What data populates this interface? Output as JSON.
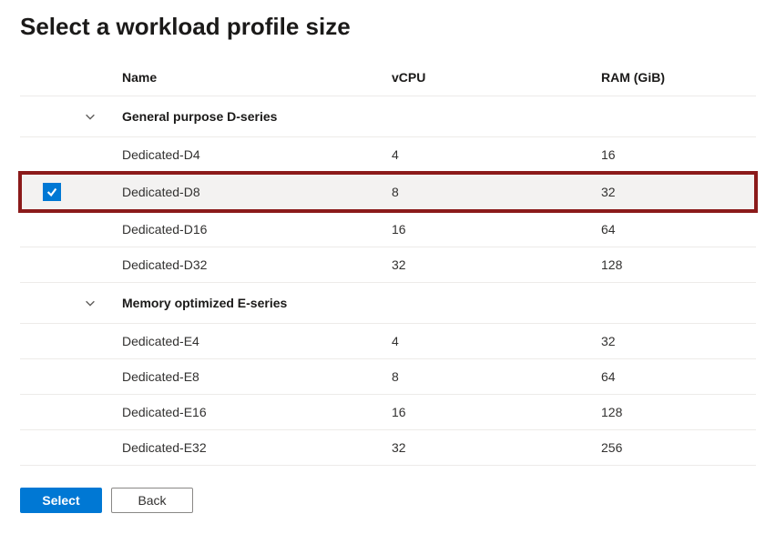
{
  "title": "Select a workload profile size",
  "columns": {
    "name": "Name",
    "vcpu": "vCPU",
    "ram": "RAM (GiB)"
  },
  "groups": [
    {
      "label": "General purpose D-series",
      "rows": [
        {
          "name": "Dedicated-D4",
          "vcpu": "4",
          "ram": "16",
          "selected": false
        },
        {
          "name": "Dedicated-D8",
          "vcpu": "8",
          "ram": "32",
          "selected": true
        },
        {
          "name": "Dedicated-D16",
          "vcpu": "16",
          "ram": "64",
          "selected": false
        },
        {
          "name": "Dedicated-D32",
          "vcpu": "32",
          "ram": "128",
          "selected": false
        }
      ]
    },
    {
      "label": "Memory optimized E-series",
      "rows": [
        {
          "name": "Dedicated-E4",
          "vcpu": "4",
          "ram": "32",
          "selected": false
        },
        {
          "name": "Dedicated-E8",
          "vcpu": "8",
          "ram": "64",
          "selected": false
        },
        {
          "name": "Dedicated-E16",
          "vcpu": "16",
          "ram": "128",
          "selected": false
        },
        {
          "name": "Dedicated-E32",
          "vcpu": "32",
          "ram": "256",
          "selected": false
        }
      ]
    }
  ],
  "buttons": {
    "select": "Select",
    "back": "Back"
  },
  "highlight_color": "#8b1a1a",
  "accent_color": "#0078d4"
}
